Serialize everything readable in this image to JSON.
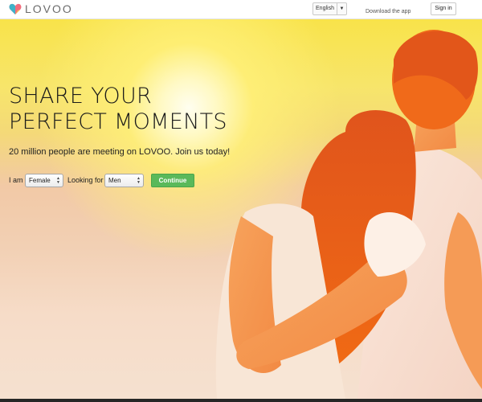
{
  "header": {
    "logo_text": "LOVOO",
    "language": "English",
    "download_label": "Download the app",
    "signin_label": "Sign in"
  },
  "hero": {
    "headline_line1": "SHARE YOUR",
    "headline_line2": "PERFECT MOMENTS",
    "tagline": "20 million people are meeting on LOVOO. Join us today!"
  },
  "form": {
    "i_am_label": "I am",
    "gender_value": "Female",
    "looking_for_label": "Looking for",
    "looking_for_value": "Men",
    "continue_label": "Continue"
  },
  "colors": {
    "accent": "#5ab95a",
    "sky_top": "#f8e34a",
    "logo_gradient": [
      "#f26d7d",
      "#3fb2c8",
      "#f7c948"
    ]
  }
}
